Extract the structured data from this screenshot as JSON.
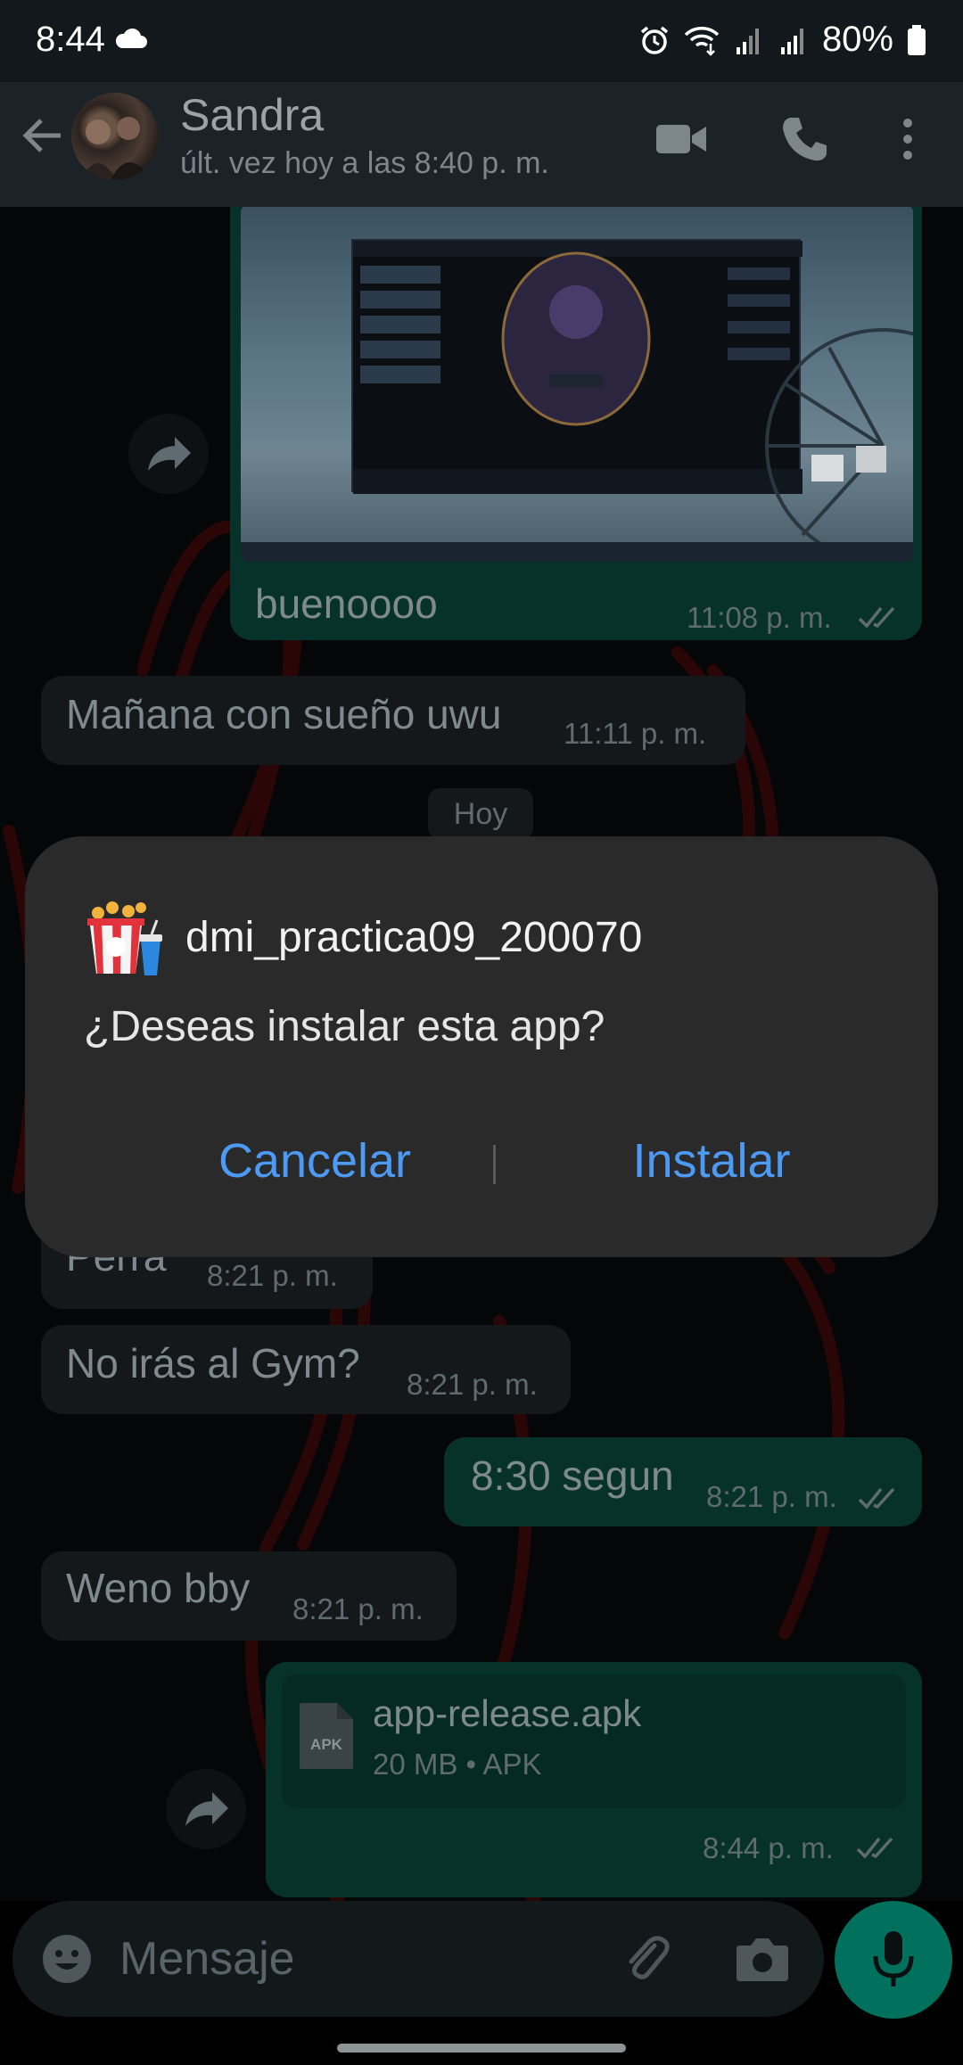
{
  "status_bar": {
    "time": "8:44",
    "battery": "80%"
  },
  "header": {
    "contact_name": "Sandra",
    "last_seen": "últ. vez hoy a las 8:40 p. m."
  },
  "messages": [
    {
      "type": "image_with_caption",
      "direction": "out",
      "text": "buenoooo",
      "time": "11:08 p. m."
    },
    {
      "type": "text",
      "direction": "in",
      "text": "Mañana con sueño uwu",
      "time": "11:11 p. m."
    },
    {
      "type": "date",
      "text": "Hoy"
    },
    {
      "type": "text",
      "direction": "in",
      "text": "Perra",
      "time": "8:21 p. m."
    },
    {
      "type": "text",
      "direction": "in",
      "text": "No irás al Gym?",
      "time": "8:21 p. m."
    },
    {
      "type": "text",
      "direction": "out",
      "text": "8:30 segun",
      "time": "8:21 p. m."
    },
    {
      "type": "text",
      "direction": "in",
      "text": "Weno bby",
      "time": "8:21 p. m."
    },
    {
      "type": "document",
      "direction": "out",
      "file_icon": "APK",
      "file_name": "app-release.apk",
      "file_meta": "20 MB • APK",
      "time": "8:44 p. m."
    }
  ],
  "composer": {
    "placeholder": "Mensaje"
  },
  "dialog": {
    "app_name": "dmi_practica09_200070",
    "question": "¿Deseas instalar esta app?",
    "cancel_label": "Cancelar",
    "install_label": "Instalar"
  },
  "colors": {
    "accent_blue": "#4d9af5",
    "outgoing_bubble": "#06322a",
    "mic_green": "#01705d",
    "dialog_bg": "#2a2a2a"
  }
}
